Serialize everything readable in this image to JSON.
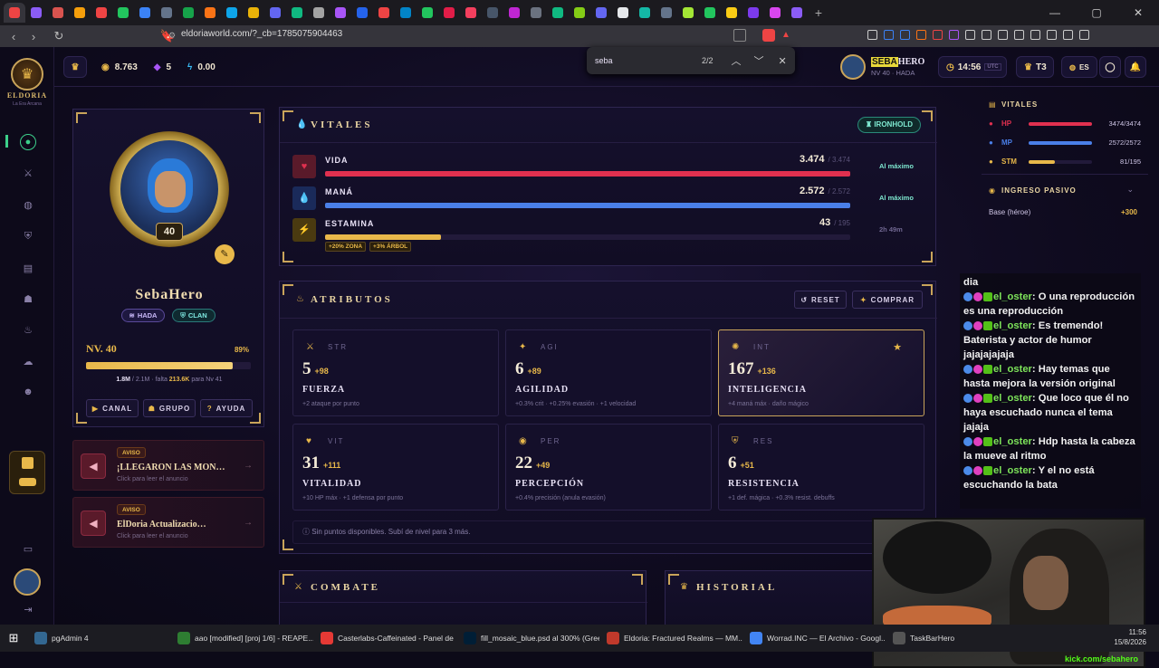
{
  "browser": {
    "url": "eldoriaworld.com/?_cb=1785075904463",
    "find_query": "seba",
    "find_count": "2/2",
    "tab_colors": [
      "#e44",
      "#8b5cf6",
      "#d9534f",
      "#f59e0b",
      "#ef4444",
      "#22c55e",
      "#3b82f6",
      "#64748b",
      "#16a34a",
      "#f97316",
      "#0ea5e9",
      "#eab308",
      "#6366f1",
      "#10b981",
      "#a3a3a3",
      "#a855f7",
      "#2563eb",
      "#ef4444",
      "#0284c7",
      "#22c55e",
      "#e11d48",
      "#f43f5e",
      "#475569",
      "#c026d3",
      "#6b7280",
      "#10b981",
      "#84cc16",
      "#6366f1",
      "#e5e7eb",
      "#14b8a6",
      "#64748b",
      "#a3e635",
      "#22c55e",
      "#facc15",
      "#7c3aed",
      "#d946ef",
      "#8b5cf6"
    ]
  },
  "brand": {
    "name": "ELDORIA",
    "tagline": "La Era Arcana"
  },
  "topbar": {
    "gold": "8.763",
    "gems": "5",
    "energy": "0.00",
    "hero_name_tag": "SEBA",
    "hero_name_rest": "HERO",
    "hero_sub": "NV 40 · HADA",
    "time": "14:56",
    "tz": "UTC",
    "tier": "T3",
    "lang": "ES"
  },
  "profile": {
    "name": "SebaHero",
    "level_badge": "40",
    "tag_race": "HADA",
    "tag_clan": "CLAN",
    "level_label": "NV. 40",
    "level_pct": "89%",
    "level_progress": 0.89,
    "xp_current": "1.8M",
    "xp_total": "2.1M",
    "xp_missing": "213.6K",
    "xp_next": "para Nv 41",
    "xp_mid": " / 2.1M · falta ",
    "links": [
      "CANAL",
      "GRUPO",
      "AYUDA"
    ]
  },
  "notices": [
    {
      "badge": "AVISO",
      "title": "¡LLEGARON LAS MON…",
      "sub": "Click para leer el anuncio"
    },
    {
      "badge": "AVISO",
      "title": "ElDoria Actualizacio…",
      "sub": "Click para leer el anuncio"
    }
  ],
  "vitales": {
    "title": "VITALES",
    "zone_badge": "IRONHOLD",
    "rows": [
      {
        "label": "VIDA",
        "value": "3.474",
        "max": "/ 3.474",
        "status": "Al máximo",
        "fill": 1.0,
        "color": "#e0304f",
        "icon": "♥"
      },
      {
        "label": "MANÁ",
        "value": "2.572",
        "max": "/ 2.572",
        "status": "Al máximo",
        "fill": 1.0,
        "color": "#4a7fe8",
        "icon": "💧"
      },
      {
        "label": "ESTAMINA",
        "value": "43",
        "max": "/ 195",
        "status": "2h 49m",
        "fill": 0.22,
        "color": "#e8b84a",
        "icon": "⚡"
      }
    ],
    "chips": [
      "+20% ZONA",
      "+3% ÁRBOL"
    ]
  },
  "atributos": {
    "title": "ATRIBUTOS",
    "reset": "RESET",
    "buy": "COMPRAR",
    "footer": "Sin puntos disponibles. Subí de nivel para 3 más.",
    "items": [
      {
        "abbr": "STR",
        "value": "5",
        "bonus": "+98",
        "name": "FUERZA",
        "desc": "+2 ataque por punto"
      },
      {
        "abbr": "AGI",
        "value": "6",
        "bonus": "+89",
        "name": "AGILIDAD",
        "desc": "+0.3% crit · +0.25% evasión · +1 velocidad"
      },
      {
        "abbr": "INT",
        "value": "167",
        "bonus": "+136",
        "name": "INTELIGENCIA",
        "desc": "+4 maná máx · daño mágico"
      },
      {
        "abbr": "VIT",
        "value": "31",
        "bonus": "+111",
        "name": "VITALIDAD",
        "desc": "+10 HP máx · +1 defensa por punto"
      },
      {
        "abbr": "PER",
        "value": "22",
        "bonus": "+49",
        "name": "PERCEPCIÓN",
        "desc": "+0.4% precisión (anula evasión)"
      },
      {
        "abbr": "RES",
        "value": "6",
        "bonus": "+51",
        "name": "RESISTENCIA",
        "desc": "+1 def. mágica · +0.3% resist. debuffs"
      }
    ]
  },
  "bottom": {
    "combate": "COMBATE",
    "historial": "HISTORIAL"
  },
  "side": {
    "vitales": "VITALES",
    "rows": [
      {
        "label": "HP",
        "value": "3474/3474",
        "fill": 1.0,
        "color": "#e0304f"
      },
      {
        "label": "MP",
        "value": "2572/2572",
        "fill": 1.0,
        "color": "#4a7fe8"
      },
      {
        "label": "STM",
        "value": "81/195",
        "fill": 0.42,
        "color": "#e8b84a"
      }
    ],
    "ingreso": "INGRESO PASIVO",
    "base_label": "Base (héroe)",
    "base_value": "+300"
  },
  "chat": {
    "lines": [
      {
        "user": "",
        "text": "dia"
      },
      {
        "user": "el_oster",
        "text": "O una reproducción es una reproducción"
      },
      {
        "user": "el_oster",
        "text": "Es tremendo! Baterista y actor de humor jajajajajaja"
      },
      {
        "user": "el_oster",
        "text": "Hay temas que hasta mejora la versión original"
      },
      {
        "user": "el_oster",
        "text": "Que loco que él no haya escuchado nunca el tema jajaja"
      },
      {
        "user": "el_oster",
        "text": "Hdp hasta la cabeza la mueve al ritmo"
      },
      {
        "user": "el_oster",
        "text": "Y el no está escuchando la bata"
      }
    ]
  },
  "cam": {
    "watermark": "kick.com/sebahero"
  },
  "taskbar": {
    "items": [
      {
        "label": "pgAdmin 4",
        "color": "#336791"
      },
      {
        "label": "aao [modified] [proj 1/6] - REAPE...",
        "color": "#2e7d32"
      },
      {
        "label": "Casterlabs-Caffeinated - Panel de ...",
        "color": "#e53935"
      },
      {
        "label": "fill_mosaic_blue.psd al 300% (Gree...",
        "color": "#001e36"
      },
      {
        "label": "Eldoria: Fractured Realms — MM...",
        "color": "#c0392b"
      },
      {
        "label": "Worrad.INC — El Archivo - Googl...",
        "color": "#4285f4"
      },
      {
        "label": "TaskBarHero",
        "color": "#555"
      }
    ],
    "time": "11:56",
    "date": "15/8/2026"
  }
}
